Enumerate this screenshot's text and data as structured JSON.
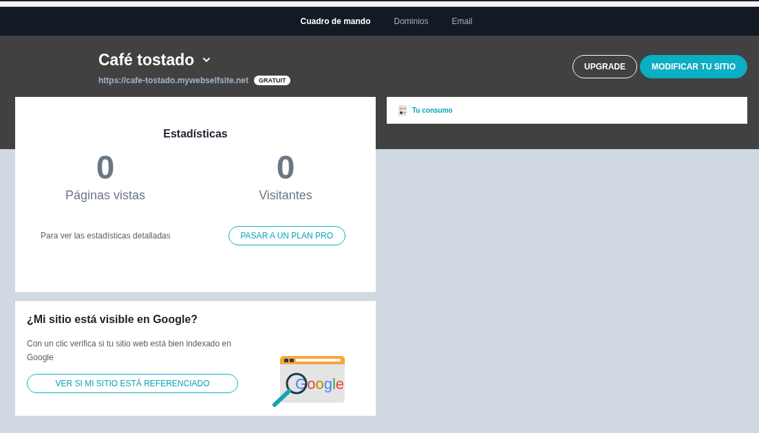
{
  "nav": [
    {
      "label": "Cuadro de mando",
      "selected": true
    },
    {
      "label": "Dominios",
      "selected": false
    },
    {
      "label": "Email",
      "selected": false
    }
  ],
  "site": {
    "title": "Café tostado",
    "url": "https://cafe-tostado.mywebselfsite.net",
    "plan_badge": "GRATUIT"
  },
  "header_buttons": [
    {
      "label": "UPGRADE",
      "kind": "outline"
    },
    {
      "label": "MODIFICAR TU SITIO",
      "kind": "primary"
    }
  ],
  "consumption_link": "Tu consumo",
  "stats": {
    "title": "Estadísticas",
    "metrics": [
      {
        "value": "0",
        "label": "Páginas vistas"
      },
      {
        "value": "0",
        "label": "Visitantes"
      }
    ],
    "note": "Para ver las estadísticas detalladas",
    "button": "PASAR A UN PLAN PRO"
  },
  "google_card": {
    "title": "¿Mi sitio está visible en Google?",
    "text": "Con un clic verifica si tu sitio web está bien indexado en Google",
    "button": "VER SI MI SITIO ESTÁ REFERENCIADO",
    "illustration_text": "Google"
  }
}
